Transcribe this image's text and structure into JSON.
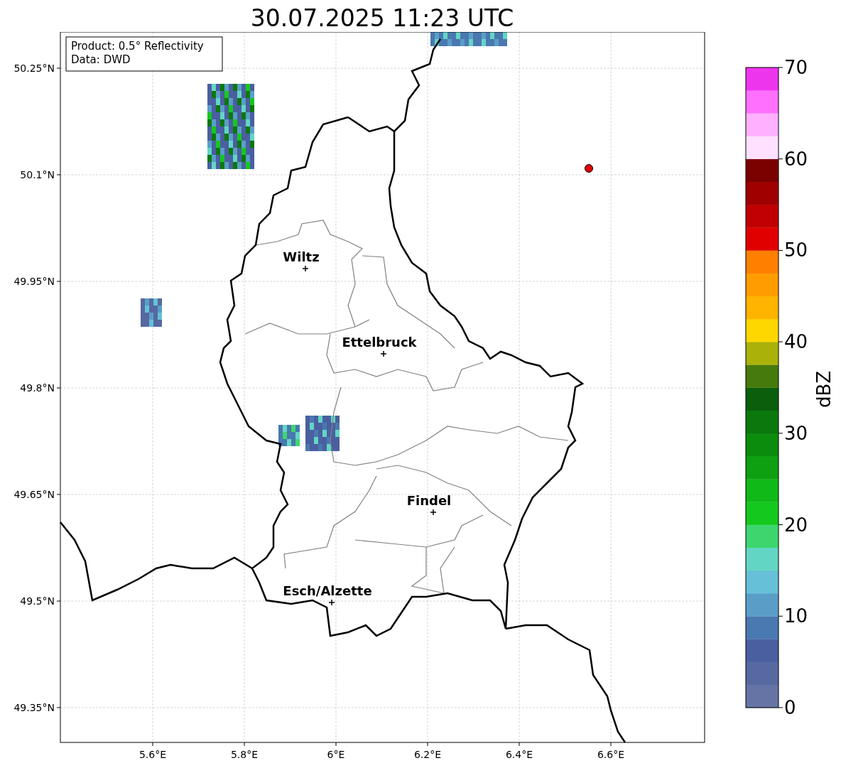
{
  "title": "30.07.2025 11:23 UTC",
  "info_box": [
    "Product: 0.5° Reflectivity",
    "Data: DWD"
  ],
  "x_ticks": [
    "5.6°E",
    "5.8°E",
    "6°E",
    "6.2°E",
    "6.4°E",
    "6.6°E"
  ],
  "y_ticks": [
    "50.25°N",
    "50.1°N",
    "49.95°N",
    "49.8°N",
    "49.65°N",
    "49.5°N",
    "49.35°N"
  ],
  "cities": [
    "Wiltz",
    "Ettelbruck",
    "Findel",
    "Esch/Alzette"
  ],
  "colorbar": {
    "label": "dBZ",
    "ticks": [
      "70",
      "60",
      "50",
      "40",
      "30",
      "20",
      "10",
      "0"
    ],
    "segments": [
      {
        "color": "#6574a5"
      },
      {
        "color": "#5669a0"
      },
      {
        "color": "#4a5fa0"
      },
      {
        "color": "#4a78b0"
      },
      {
        "color": "#5a9ec8"
      },
      {
        "color": "#65c0d8"
      },
      {
        "color": "#63d5c5"
      },
      {
        "color": "#3dd66e"
      },
      {
        "color": "#14c81e"
      },
      {
        "color": "#10b818"
      },
      {
        "color": "#0ea010"
      },
      {
        "color": "#0c8c0c"
      },
      {
        "color": "#0b780d"
      },
      {
        "color": "#0a5e0c"
      },
      {
        "color": "#467a0c"
      },
      {
        "color": "#aab20a"
      },
      {
        "color": "#ffd700"
      },
      {
        "color": "#ffb400"
      },
      {
        "color": "#ff9c00"
      },
      {
        "color": "#ff7f00"
      },
      {
        "color": "#e00000"
      },
      {
        "color": "#c00000"
      },
      {
        "color": "#a00000"
      },
      {
        "color": "#7b0000"
      },
      {
        "color": "#ffe0ff"
      },
      {
        "color": "#ffb0ff"
      },
      {
        "color": "#ff70ff"
      },
      {
        "color": "#ee35ee"
      }
    ]
  }
}
